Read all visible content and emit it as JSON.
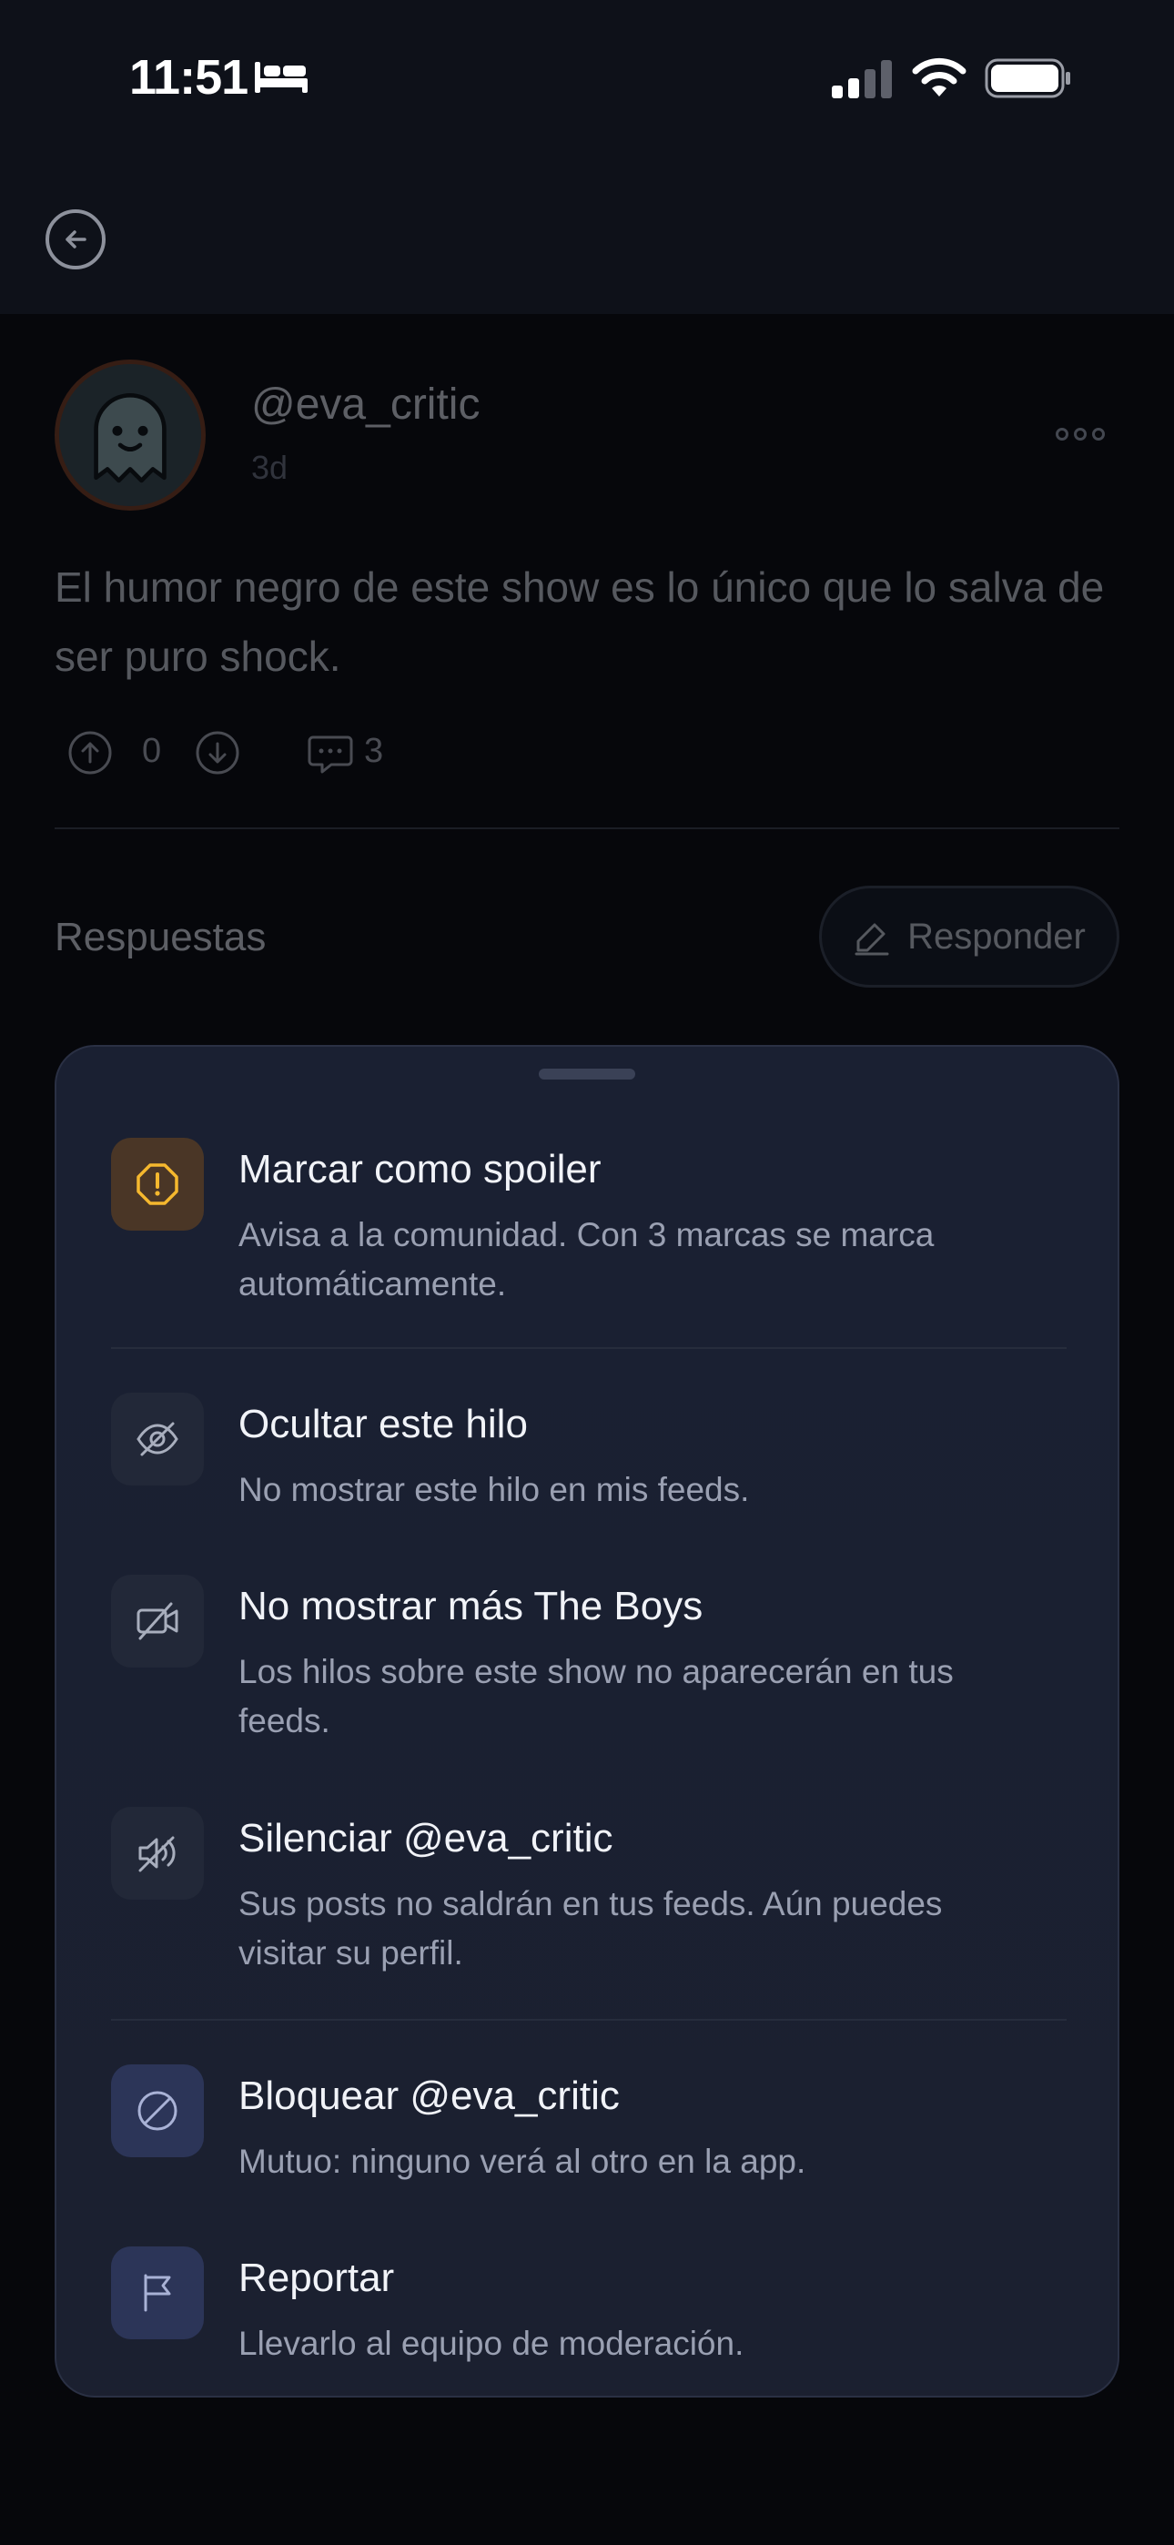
{
  "status_bar": {
    "time": "11:51"
  },
  "post": {
    "username": "@eva_critic",
    "time_ago": "3d",
    "text": "El humor negro de este show es lo único que lo salva de ser puro shock.",
    "upvotes": "0",
    "comments": "3"
  },
  "replies": {
    "title": "Respuestas",
    "reply_button": "Responder"
  },
  "sheet": {
    "items": [
      {
        "title": "Marcar como spoiler",
        "desc": "Avisa a la comunidad. Con 3 marcas se marca automáticamente.",
        "icon": "warning-icon"
      },
      {
        "title": "Ocultar este hilo",
        "desc": "No mostrar este hilo en mis feeds.",
        "icon": "eye-off-icon"
      },
      {
        "title": "No mostrar más The Boys",
        "desc": "Los hilos sobre este show no aparecerán en tus feeds.",
        "icon": "video-off-icon"
      },
      {
        "title": "Silenciar @eva_critic",
        "desc": "Sus posts no saldrán en tus feeds. Aún puedes visitar su perfil.",
        "icon": "mute-icon"
      },
      {
        "title": "Bloquear @eva_critic",
        "desc": "Mutuo: ninguno verá al otro en la app.",
        "icon": "block-icon"
      },
      {
        "title": "Reportar",
        "desc": "Llevarlo al equipo de moderación.",
        "icon": "flag-icon"
      }
    ]
  },
  "colors": {
    "background": "#06070b",
    "sheet": "#1a2032",
    "warning_accent": "#f5b82e",
    "avatar_border": "#7a3d22"
  }
}
